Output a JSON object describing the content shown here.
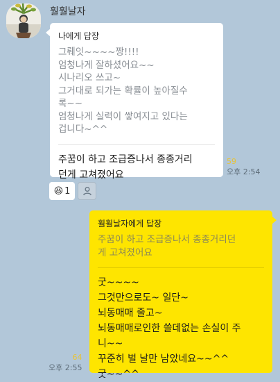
{
  "chat": {
    "sender_name": "훨훨날자",
    "incoming": {
      "reply_title": "나에게 답장",
      "quoted_text": "그뤠잇~~~~짱!!!!\n엄청나게 잘하셨어요~~\n시나리오 쓰고~\n그거대로 되가는 확률이 높아질수\n록~~\n엄청나게 실력이 쌓여지고 있다는\n겁니다~^^",
      "message": "주꿈이 하고 조급증나서 종종거리\n던게 고쳐졌어요",
      "unread_count": "59",
      "time": "오후 2:54"
    },
    "reaction": {
      "emoji": "😆",
      "count": "1"
    },
    "outgoing": {
      "reply_title": "훨훨날자에게 답장",
      "quoted_text": "주꿈이 하고 조급증나서 종종거리던\n게 고쳐졌어요",
      "message": "굿~~~~\n그것만으로도~ 일단~\n뇌동매매 줄고~\n뇌동매매로인한 쓸데없는 손실이 주\n니~~\n꾸준히 벌 날만 남았네요~~^^\n굿~~^^",
      "unread_count": "64",
      "time": "오후 2:55"
    }
  },
  "icons": {
    "avatar": "profile-photo-plant",
    "add_reaction": "person-icon"
  },
  "colors": {
    "background": "#b2c7d9",
    "incoming_bubble": "#ffffff",
    "outgoing_bubble": "#fee500",
    "unread": "#e8c338"
  }
}
